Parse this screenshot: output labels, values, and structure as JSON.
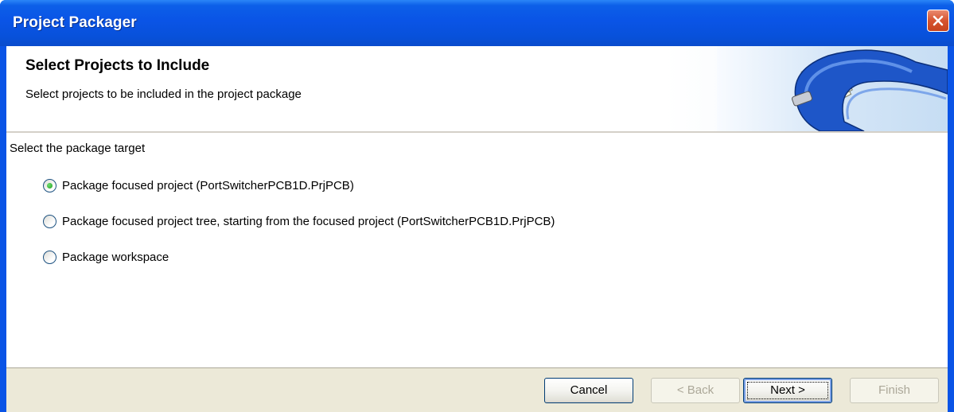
{
  "window": {
    "title": "Project Packager"
  },
  "header": {
    "title": "Select Projects to Include",
    "subtitle": "Select projects to be included in the project package"
  },
  "content": {
    "section_label": "Select the package target",
    "options": [
      {
        "label": "Package focused project (PortSwitcherPCB1D.PrjPCB)",
        "selected": true
      },
      {
        "label": "Package focused project tree, starting from the focused project (PortSwitcherPCB1D.PrjPCB)",
        "selected": false
      },
      {
        "label": "Package workspace",
        "selected": false
      }
    ]
  },
  "buttons": {
    "cancel": "Cancel",
    "back": "< Back",
    "next": "Next >",
    "finish": "Finish"
  },
  "colors": {
    "titlebar": "#0a54e6",
    "close_button": "#d7542f",
    "selected_radio": "#21a121",
    "dialog_face": "#ece9d8"
  }
}
